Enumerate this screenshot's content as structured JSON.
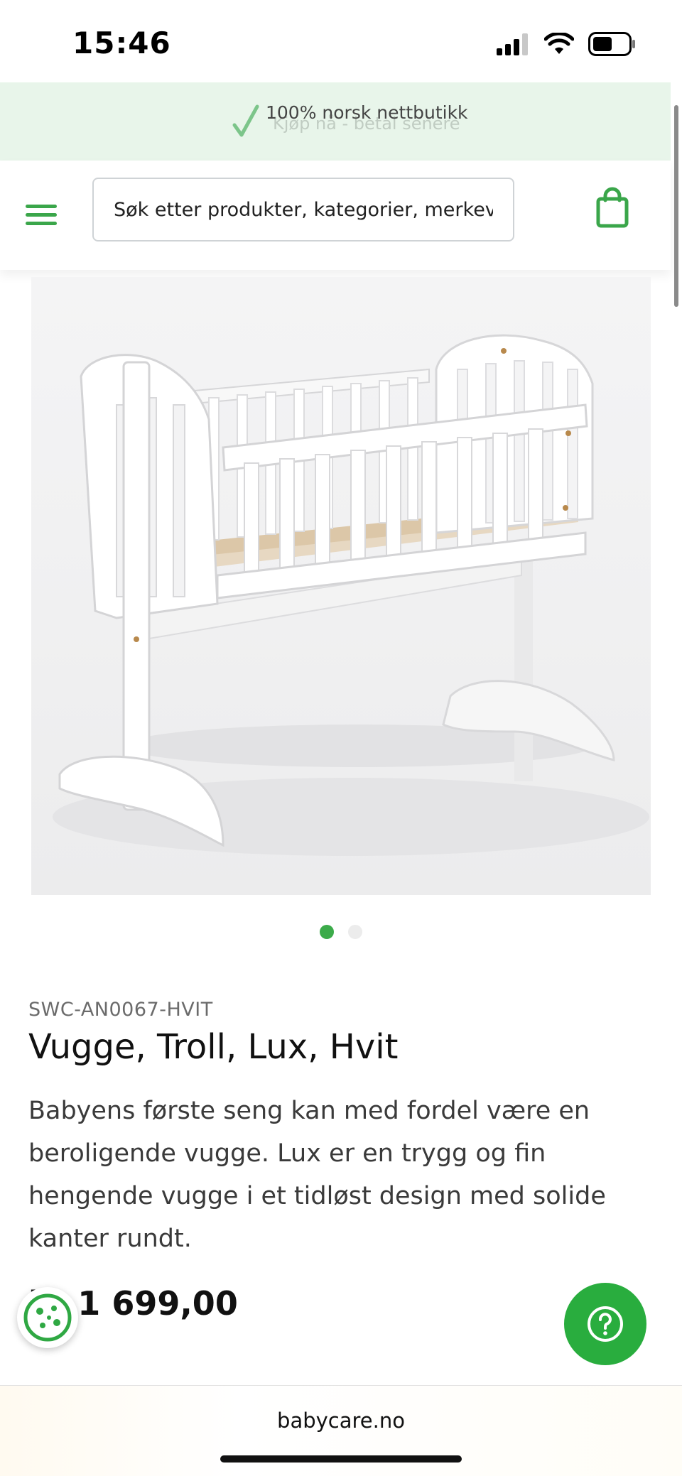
{
  "status_bar": {
    "time": "15:46",
    "signal_icon": "cellular-signal-icon",
    "wifi_icon": "wifi-icon",
    "battery_icon": "battery-icon"
  },
  "promo_banner": {
    "text": "100% norsk nettbutikk",
    "ghost_text": "Kjøp nå - betal senere",
    "icon": "check-icon"
  },
  "header": {
    "menu_icon": "hamburger-menu-icon",
    "search_placeholder": "Søk etter produkter, kategorier, merkevarer",
    "cart_icon": "shopping-bag-icon"
  },
  "gallery": {
    "image_alt": "Vugge, Troll, Lux, Hvit",
    "slide_count": 2,
    "active_slide": 1
  },
  "product": {
    "sku": "SWC-AN0067-HVIT",
    "title": "Vugge, Troll, Lux, Hvit",
    "description": "Babyens første seng kan med fordel være en beroligende vugge. Lux er en trygg og fin hengende vugge i et tidløst design med solide kanter rundt.",
    "price": "kr 1 699,00"
  },
  "floating": {
    "cookie_icon": "cookie-icon",
    "help_icon": "question-mark-icon"
  },
  "browser": {
    "url": "babycare.no"
  },
  "colors": {
    "brand_green": "#3aa64a",
    "help_green": "#29ad3e",
    "banner_bg": "#e8f5ea"
  }
}
